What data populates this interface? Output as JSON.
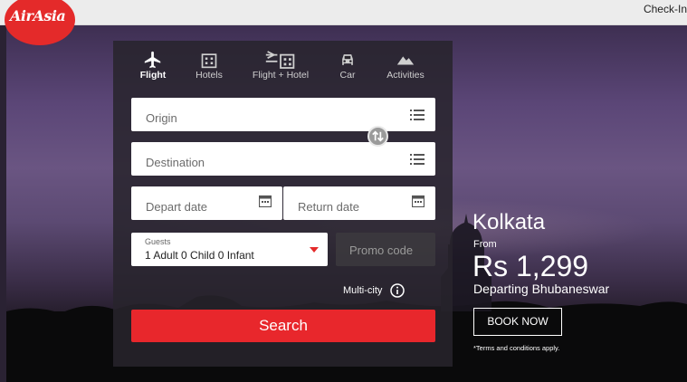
{
  "header": {
    "checkin_label": "Check-In"
  },
  "brand": {
    "logo_text": "AirAsia",
    "color": "#e42a2a"
  },
  "tabs": [
    {
      "label": "Flight",
      "icon": "plane-icon",
      "active": true
    },
    {
      "label": "Hotels",
      "icon": "building-icon",
      "active": false
    },
    {
      "label": "Flight + Hotel",
      "icon": "plane-building-icon",
      "active": false
    },
    {
      "label": "Car",
      "icon": "car-icon",
      "active": false
    },
    {
      "label": "Activities",
      "icon": "mountain-icon",
      "active": false
    }
  ],
  "form": {
    "origin_placeholder": "Origin",
    "destination_placeholder": "Destination",
    "depart_placeholder": "Depart date",
    "return_placeholder": "Return date",
    "guests_label": "Guests",
    "guests_value": "1 Adult 0 Child 0 Infant",
    "promo_placeholder": "Promo code",
    "multicity_label": "Multi-city",
    "search_label": "Search"
  },
  "promo": {
    "city": "Kolkata",
    "from_label": "From",
    "price": "Rs 1,299",
    "departing": "Departing Bhubaneswar",
    "book_label": "BOOK NOW",
    "terms": "*Terms and conditions apply."
  },
  "colors": {
    "accent": "#e8272c",
    "panel": "#28242c"
  }
}
